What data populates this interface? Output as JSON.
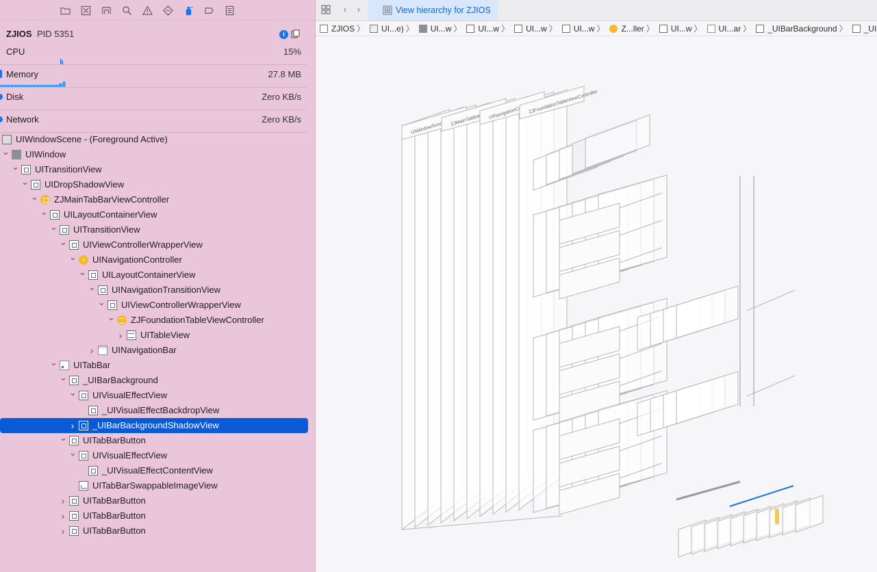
{
  "process": {
    "name": "ZJIOS",
    "pid_label": "PID 5351"
  },
  "gauges": [
    {
      "name": "CPU",
      "value": "15%"
    },
    {
      "name": "Memory",
      "value": "27.8 MB"
    },
    {
      "name": "Disk",
      "value": "Zero KB/s"
    },
    {
      "name": "Network",
      "value": "Zero KB/s"
    }
  ],
  "tree": [
    {
      "label": "UIWindowScene - (Foreground Active)",
      "icon": "scene-icon",
      "expanded": null
    },
    {
      "label": "UIWindow",
      "icon": "window-icon",
      "expanded": true
    },
    {
      "label": "UITransitionView",
      "icon": "view-icon",
      "expanded": true
    },
    {
      "label": "UIDropShadowView",
      "icon": "view-icon",
      "expanded": true
    },
    {
      "label": "ZJMainTabBarViewController",
      "icon": "view-controller-icon",
      "expanded": true
    },
    {
      "label": "UILayoutContainerView",
      "icon": "view-icon",
      "expanded": true
    },
    {
      "label": "UITransitionView",
      "icon": "view-icon",
      "expanded": true
    },
    {
      "label": "UIViewControllerWrapperView",
      "icon": "view-icon",
      "expanded": true
    },
    {
      "label": "UINavigationController",
      "icon": "navigation-controller-icon",
      "expanded": true
    },
    {
      "label": "UILayoutContainerView",
      "icon": "view-icon",
      "expanded": true
    },
    {
      "label": "UINavigationTransitionView",
      "icon": "view-icon",
      "expanded": true
    },
    {
      "label": "UIViewControllerWrapperView",
      "icon": "view-icon",
      "expanded": true
    },
    {
      "label": "ZJFoundationTableViewController",
      "icon": "table-view-controller-icon",
      "expanded": true
    },
    {
      "label": "UITableView",
      "icon": "table-view-icon",
      "expanded": false
    },
    {
      "label": "UINavigationBar",
      "icon": "navigation-bar-icon",
      "expanded": false
    },
    {
      "label": "UITabBar",
      "icon": "tab-bar-icon",
      "expanded": true
    },
    {
      "label": "_UIBarBackground",
      "icon": "view-icon",
      "expanded": true
    },
    {
      "label": "UIVisualEffectView",
      "icon": "view-icon",
      "expanded": true
    },
    {
      "label": "_UIVisualEffectBackdropView",
      "icon": "view-icon",
      "expanded": null
    },
    {
      "label": "_UIBarBackgroundShadowView",
      "icon": "view-icon",
      "expanded": false,
      "selected": true
    },
    {
      "label": "UITabBarButton",
      "icon": "view-icon",
      "expanded": true
    },
    {
      "label": "UIVisualEffectView",
      "icon": "view-icon",
      "expanded": true
    },
    {
      "label": "_UIVisualEffectContentView",
      "icon": "view-icon",
      "expanded": null
    },
    {
      "label": "UITabBarSwappableImageView",
      "icon": "image-view-icon",
      "expanded": null
    },
    {
      "label": "UITabBarButton",
      "icon": "view-icon",
      "expanded": false
    },
    {
      "label": "UITabBarButton",
      "icon": "view-icon",
      "expanded": false
    },
    {
      "label": "UITabBarButton",
      "icon": "view-icon",
      "expanded": false
    }
  ],
  "editor": {
    "tab_title": "View hierarchy for ZJIOS",
    "breadcrumbs": [
      {
        "label": "ZJIOS",
        "icon": "app-icon"
      },
      {
        "label": "UI...e)",
        "icon": "scene-icon"
      },
      {
        "label": "UI...w",
        "icon": "window-icon"
      },
      {
        "label": "UI...w",
        "icon": "view-icon"
      },
      {
        "label": "UI...w",
        "icon": "view-icon"
      },
      {
        "label": "UI...w",
        "icon": "view-icon"
      },
      {
        "label": "Z...ller",
        "icon": "view-controller-icon"
      },
      {
        "label": "UI...w",
        "icon": "view-icon"
      },
      {
        "label": "UI...ar",
        "icon": "tab-bar-icon"
      },
      {
        "label": "_UIBarBackground",
        "icon": "view-icon"
      },
      {
        "label": "_UIBarBackgroundShadowView",
        "icon": "view-icon"
      }
    ],
    "canvas_labels": [
      "UIWindowScene - (Foreground Active)",
      "ZJMainTabBarViewController",
      "UINavigationController",
      "ZJFoundationTableViewController"
    ]
  },
  "colors": {
    "selection": "#0a5ad8",
    "sidebar_bg": "#e9c6da",
    "tab_active": "#d8e7fb",
    "accent": "#1a73e8"
  }
}
